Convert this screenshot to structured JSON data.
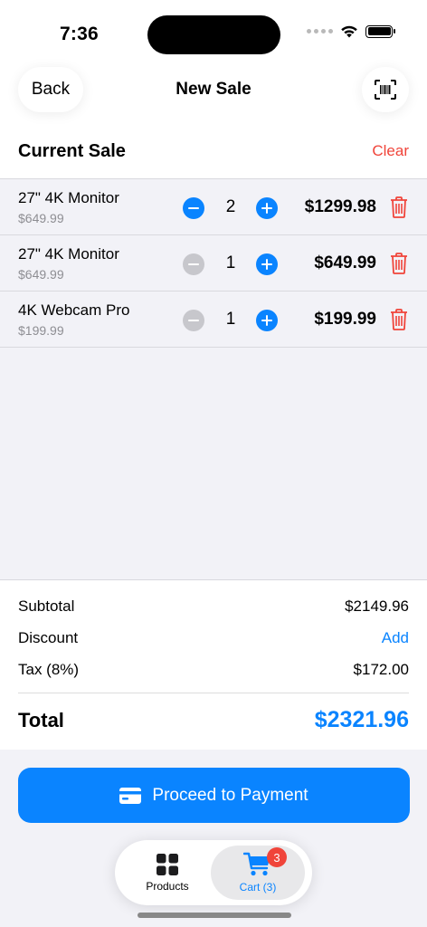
{
  "status_bar": {
    "time": "7:36"
  },
  "nav": {
    "back_label": "Back",
    "title": "New Sale",
    "scan_icon": "barcode-scan-icon"
  },
  "section": {
    "title": "Current Sale",
    "clear_label": "Clear"
  },
  "items": [
    {
      "name": "27\" 4K Monitor",
      "unit_price": "$649.99",
      "quantity": "2",
      "line_total": "$1299.98",
      "minus_enabled": true
    },
    {
      "name": "27\" 4K Monitor",
      "unit_price": "$649.99",
      "quantity": "1",
      "line_total": "$649.99",
      "minus_enabled": false
    },
    {
      "name": "4K Webcam Pro",
      "unit_price": "$199.99",
      "quantity": "1",
      "line_total": "$199.99",
      "minus_enabled": false
    }
  ],
  "summary": {
    "subtotal_label": "Subtotal",
    "subtotal_value": "$2149.96",
    "discount_label": "Discount",
    "discount_action": "Add",
    "tax_label": "Tax (8%)",
    "tax_value": "$172.00",
    "total_label": "Total",
    "total_value": "$2321.96"
  },
  "payment": {
    "label": "Proceed to Payment"
  },
  "tabs": {
    "products_label": "Products",
    "cart_label": "Cart (3)",
    "cart_badge": "3"
  },
  "colors": {
    "accent": "#0a84ff",
    "destructive": "#f0443a",
    "background_grouped": "#f2f2f7"
  }
}
